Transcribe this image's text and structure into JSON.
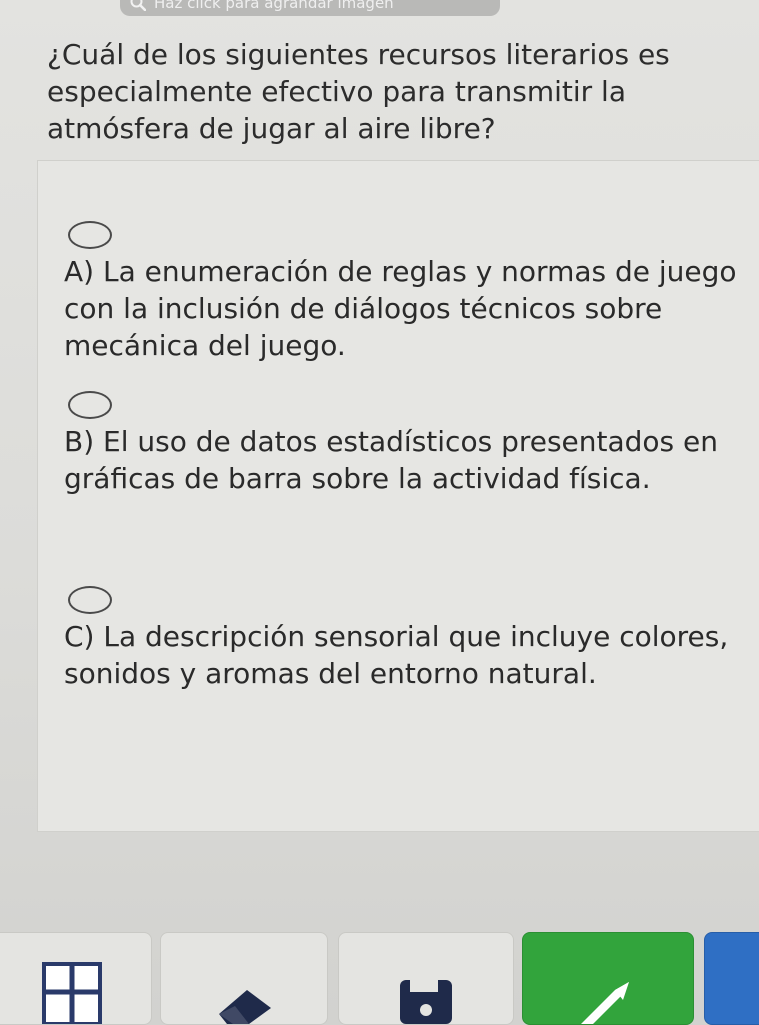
{
  "top_hint": {
    "label": "Haz click para agrandar imagen",
    "icon": "zoom-icon"
  },
  "question": {
    "text": "¿Cuál de los siguientes recursos literarios es especialmente efectivo para transmitir la atmósfera de jugar al aire libre?"
  },
  "options": [
    {
      "selected": false,
      "text": "A) La enumeración de reglas y normas de juego con la inclusión de diálogos técnicos sobre mecánica del juego."
    },
    {
      "selected": false,
      "text": "B) El uso de datos estadísticos presentados en gráficas de barra sobre la actividad física."
    },
    {
      "selected": false,
      "text": "C) La descripción sensorial que incluye colores, sonidos y aromas del entorno natural."
    }
  ],
  "toolbar": {
    "buttons": [
      {
        "icon": "table-icon"
      },
      {
        "icon": "eraser-icon"
      },
      {
        "icon": "save-icon"
      },
      {
        "icon": "send-icon"
      },
      {
        "icon": "unknown-icon"
      }
    ],
    "colors": {
      "submit": "#32a43c",
      "extra": "#2f6fc4"
    }
  }
}
